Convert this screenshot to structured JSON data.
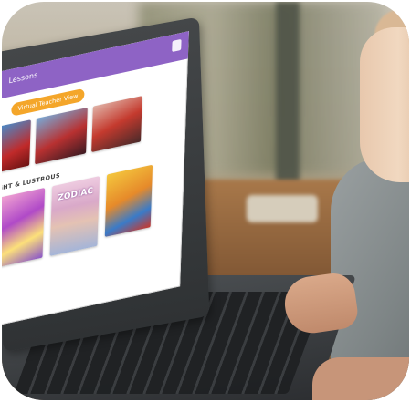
{
  "app": {
    "title": "Lessons",
    "header_color": "#8e63c5"
  },
  "toolbar": {
    "virtual_teacher_label": "Virtual Teacher View",
    "button_color": "#f4a62a",
    "bag_icon": "bag-icon"
  },
  "sections": [
    {
      "label": "",
      "covers": [
        "cover-1",
        "cover-2",
        "cover-3"
      ]
    },
    {
      "label": "GHT & LUSTROUS",
      "covers": [
        "cover-4",
        "cover-5",
        "cover-6"
      ],
      "cover_texts": {
        "cover-5": "ZODIAC"
      }
    }
  ]
}
